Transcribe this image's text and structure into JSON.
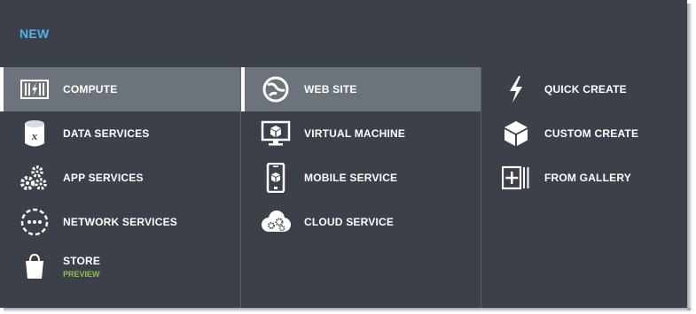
{
  "header": {
    "title": "NEW"
  },
  "categories": [
    {
      "label": "COMPUTE",
      "icon": "compute-icon",
      "selected": true
    },
    {
      "label": "DATA SERVICES",
      "icon": "database-icon"
    },
    {
      "label": "APP SERVICES",
      "icon": "gears-icon"
    },
    {
      "label": "NETWORK SERVICES",
      "icon": "network-icon"
    },
    {
      "label": "STORE",
      "sublabel": "PREVIEW",
      "icon": "shopping-bag-icon"
    }
  ],
  "compute_items": [
    {
      "label": "WEB SITE",
      "icon": "web-site-icon",
      "selected": true
    },
    {
      "label": "VIRTUAL MACHINE",
      "icon": "monitor-cube-icon"
    },
    {
      "label": "MOBILE SERVICE",
      "icon": "mobile-phone-icon"
    },
    {
      "label": "CLOUD SERVICE",
      "icon": "cloud-gears-icon"
    }
  ],
  "create_options": [
    {
      "label": "QUICK CREATE",
      "icon": "lightning-icon"
    },
    {
      "label": "CUSTOM CREATE",
      "icon": "cube-icon"
    },
    {
      "label": "FROM GALLERY",
      "icon": "gallery-plus-icon"
    }
  ],
  "colors": {
    "panel_bg": "#3b4049",
    "selected_bg": "#6d737b",
    "title": "#4db2e8",
    "preview": "#8bc34a"
  }
}
